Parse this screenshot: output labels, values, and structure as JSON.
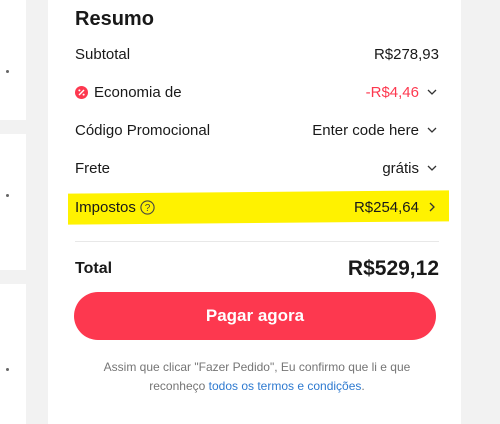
{
  "summary": {
    "title": "Resumo",
    "subtotal": {
      "label": "Subtotal",
      "value": "R$278,93"
    },
    "discount": {
      "label": "Economia de",
      "value": "-R$4,46"
    },
    "promo": {
      "label": "Código Promocional",
      "value": "Enter code here"
    },
    "shipping": {
      "label": "Frete",
      "value": "grátis"
    },
    "taxes": {
      "label": "Impostos",
      "value": "R$254,64"
    },
    "total": {
      "label": "Total",
      "value": "R$529,12"
    }
  },
  "pay_button": {
    "label": "Pagar agora"
  },
  "terms": {
    "prefix": "Assim que clicar \"Fazer Pedido\", Eu confirmo que li e que reconheço ",
    "link": "todos os termos e condições",
    "suffix": "."
  },
  "colors": {
    "accent": "#fd384f",
    "highlight": "#fff200",
    "link": "#2e7ad0"
  },
  "icons": {
    "discount": "discount-badge-icon",
    "chevron": "chevron-down-icon",
    "help": "help-circle-icon",
    "chevron_right": "chevron-right-icon"
  }
}
